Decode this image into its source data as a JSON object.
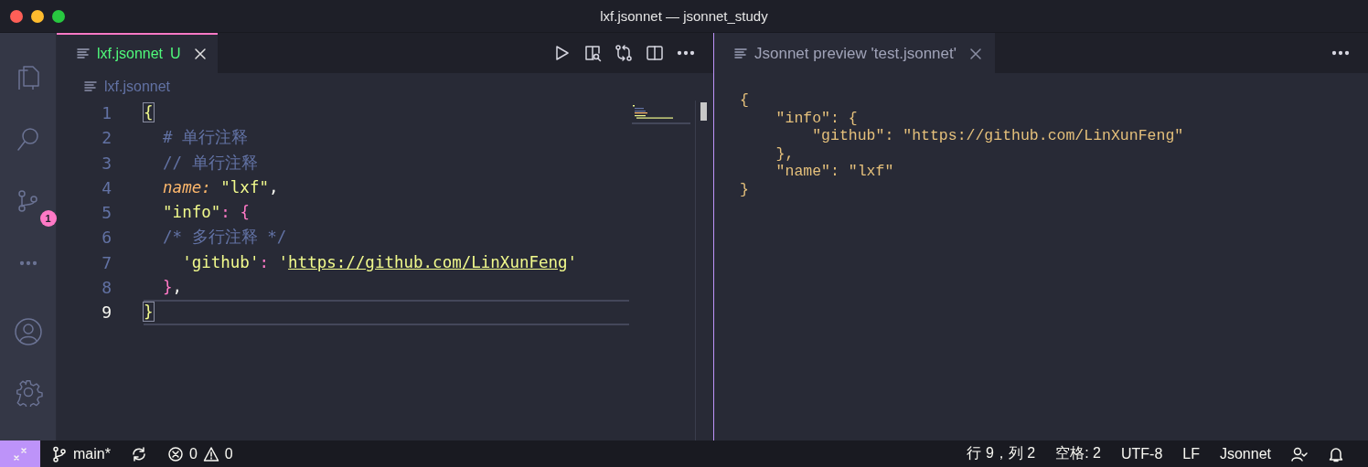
{
  "window": {
    "title": "lxf.jsonnet — jsonnet_study"
  },
  "activity_bar": {
    "top": [
      {
        "kind": "files"
      },
      {
        "kind": "search"
      },
      {
        "kind": "source-control",
        "badge": "1"
      },
      {
        "kind": "more"
      }
    ],
    "bottom": [
      {
        "kind": "account"
      },
      {
        "kind": "settings"
      }
    ]
  },
  "editor_groups": [
    {
      "focused": true,
      "tabs": [
        {
          "label": "lxf.jsonnet",
          "status": "U",
          "selected": true
        }
      ],
      "actions": [
        {
          "kind": "run"
        },
        {
          "kind": "preview"
        },
        {
          "kind": "compare"
        },
        {
          "kind": "split"
        },
        {
          "kind": "more"
        }
      ],
      "breadcrumb": "lxf.jsonnet",
      "lines": [
        {
          "number": "1",
          "current": false,
          "tokens": [
            {
              "kind": "bracket-match",
              "text": "{"
            }
          ]
        },
        {
          "number": "2",
          "current": false,
          "tokens": [
            {
              "kind": "comment",
              "text": "  # 单行注释"
            }
          ]
        },
        {
          "number": "3",
          "current": false,
          "tokens": [
            {
              "kind": "comment",
              "text": "  // 单行注释"
            }
          ]
        },
        {
          "number": "4",
          "current": false,
          "tokens": [
            {
              "kind": "field",
              "text": "  name:"
            },
            {
              "kind": "string",
              "text": " \"lxf\""
            },
            {
              "kind": "plain",
              "text": ","
            }
          ]
        },
        {
          "number": "5",
          "current": false,
          "tokens": [
            {
              "kind": "string",
              "text": "  \"info\""
            },
            {
              "kind": "operator",
              "text": ":"
            },
            {
              "kind": "brace",
              "text": " {"
            }
          ]
        },
        {
          "number": "6",
          "current": false,
          "tokens": [
            {
              "kind": "comment",
              "text": "  /* 多行注释 */"
            }
          ]
        },
        {
          "number": "7",
          "current": false,
          "tokens": [
            {
              "kind": "string",
              "text": "    'github'"
            },
            {
              "kind": "operator",
              "text": ":"
            },
            {
              "kind": "string",
              "text": " '"
            },
            {
              "kind": "link",
              "text": "https://github.com/LinXunFeng"
            },
            {
              "kind": "string",
              "text": "'"
            }
          ]
        },
        {
          "number": "8",
          "current": false,
          "tokens": [
            {
              "kind": "brace",
              "text": "  }"
            },
            {
              "kind": "plain",
              "text": ","
            }
          ]
        },
        {
          "number": "9",
          "current": true,
          "tokens": [
            {
              "kind": "bracket-match",
              "text": "}"
            }
          ]
        }
      ]
    },
    {
      "focused": false,
      "tabs": [
        {
          "label": "Jsonnet preview 'test.jsonnet'",
          "selected": true
        }
      ],
      "actions": [
        {
          "kind": "more"
        }
      ],
      "preview_lines": [
        "{",
        "    \"info\": {",
        "        \"github\": \"https://github.com/LinXunFeng\"",
        "    },",
        "    \"name\": \"lxf\"",
        "}"
      ]
    }
  ],
  "status_bar": {
    "left": [
      {
        "kind": "remote"
      },
      {
        "kind": "branch",
        "text": "main*"
      },
      {
        "kind": "sync"
      },
      {
        "kind": "problems",
        "errors": "0",
        "warnings": "0"
      }
    ],
    "right": [
      {
        "kind": "text",
        "text": "行 9，列 2"
      },
      {
        "kind": "text",
        "text": "空格: 2"
      },
      {
        "kind": "text",
        "text": "UTF-8"
      },
      {
        "kind": "text",
        "text": "LF"
      },
      {
        "kind": "text",
        "text": "Jsonnet"
      },
      {
        "kind": "feedback"
      },
      {
        "kind": "bell"
      }
    ]
  }
}
